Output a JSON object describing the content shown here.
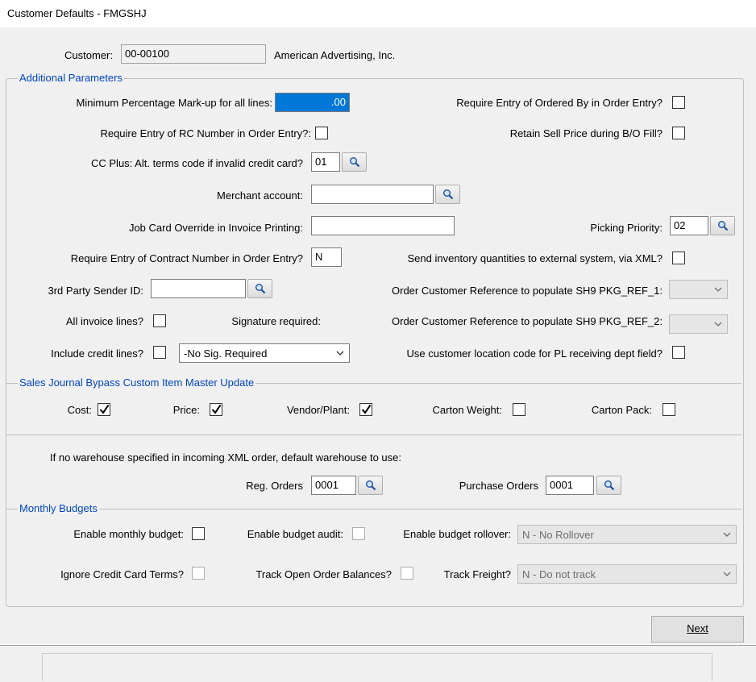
{
  "window": {
    "title": "Customer Defaults - FMGSHJ"
  },
  "customer": {
    "label": "Customer:",
    "code": "00-00100",
    "name": "American Advertising, Inc."
  },
  "additional": {
    "legend": "Additional Parameters",
    "min_markup_label": "Minimum Percentage Mark-up for all lines:",
    "min_markup_value": ".00",
    "req_ordered_by_label": "Require Entry of Ordered By in Order Entry?",
    "req_ordered_by_checked": false,
    "req_rc_label": "Require Entry of RC Number in Order Entry?:",
    "req_rc_checked": false,
    "retain_sell_label": "Retain Sell Price during B/O Fill?",
    "retain_sell_checked": false,
    "cc_plus_label": "CC Plus: Alt. terms code if invalid credit card?",
    "cc_plus_value": "01",
    "merchant_label": "Merchant account:",
    "merchant_value": "",
    "job_card_label": "Job Card Override in Invoice Printing:",
    "job_card_value": "",
    "picking_priority_label": "Picking Priority:",
    "picking_priority_value": "02",
    "contract_label": "Require Entry of Contract Number in Order Entry?",
    "contract_value": "N",
    "send_inv_label": "Send inventory quantities to external system, via XML?",
    "send_inv_checked": false,
    "third_party_label": "3rd Party Sender ID:",
    "third_party_value": "",
    "ref1_label": "Order Customer Reference to populate SH9 PKG_REF_1:",
    "ref1_value": "",
    "all_invoice_label": "All invoice lines?",
    "all_invoice_checked": false,
    "signature_label": "Signature required:",
    "ref2_label": "Order Customer Reference to populate SH9 PKG_REF_2:",
    "ref2_value": "",
    "include_credit_label": "Include credit lines?",
    "include_credit_checked": false,
    "signature_value": "-No Sig. Required",
    "use_location_label": "Use customer location code for PL receiving dept field?",
    "use_location_checked": false
  },
  "sales_journal": {
    "legend": "Sales Journal Bypass Custom Item Master Update",
    "cost_label": "Cost:",
    "cost_checked": true,
    "price_label": "Price:",
    "price_checked": true,
    "vendor_label": "Vendor/Plant:",
    "vendor_checked": true,
    "carton_weight_label": "Carton Weight:",
    "carton_weight_checked": false,
    "carton_pack_label": "Carton Pack:",
    "carton_pack_checked": false
  },
  "warehouse": {
    "text": "If no warehouse specified in incoming XML order, default warehouse to use:",
    "reg_label": "Reg. Orders",
    "reg_value": "0001",
    "po_label": "Purchase Orders",
    "po_value": "0001"
  },
  "budgets": {
    "legend": "Monthly Budgets",
    "enable_monthly_label": "Enable monthly budget:",
    "enable_monthly_checked": false,
    "enable_audit_label": "Enable budget audit:",
    "enable_audit_checked": false,
    "enable_rollover_label": "Enable budget rollover:",
    "rollover_value": "N - No Rollover",
    "ignore_cc_label": "Ignore Credit Card Terms?",
    "ignore_cc_checked": false,
    "track_open_label": "Track Open Order Balances?",
    "track_open_checked": false,
    "track_freight_label": "Track Freight?",
    "track_freight_value": "N - Do not track"
  },
  "buttons": {
    "next_label": "Next"
  },
  "icons": {
    "lookup": "magnifier-icon",
    "dropdown": "chevron-down-icon",
    "check": "checkmark-icon"
  },
  "colors": {
    "legend": "#0045c0",
    "selection": "#0078d7",
    "form_bg": "#f0f0f0"
  }
}
